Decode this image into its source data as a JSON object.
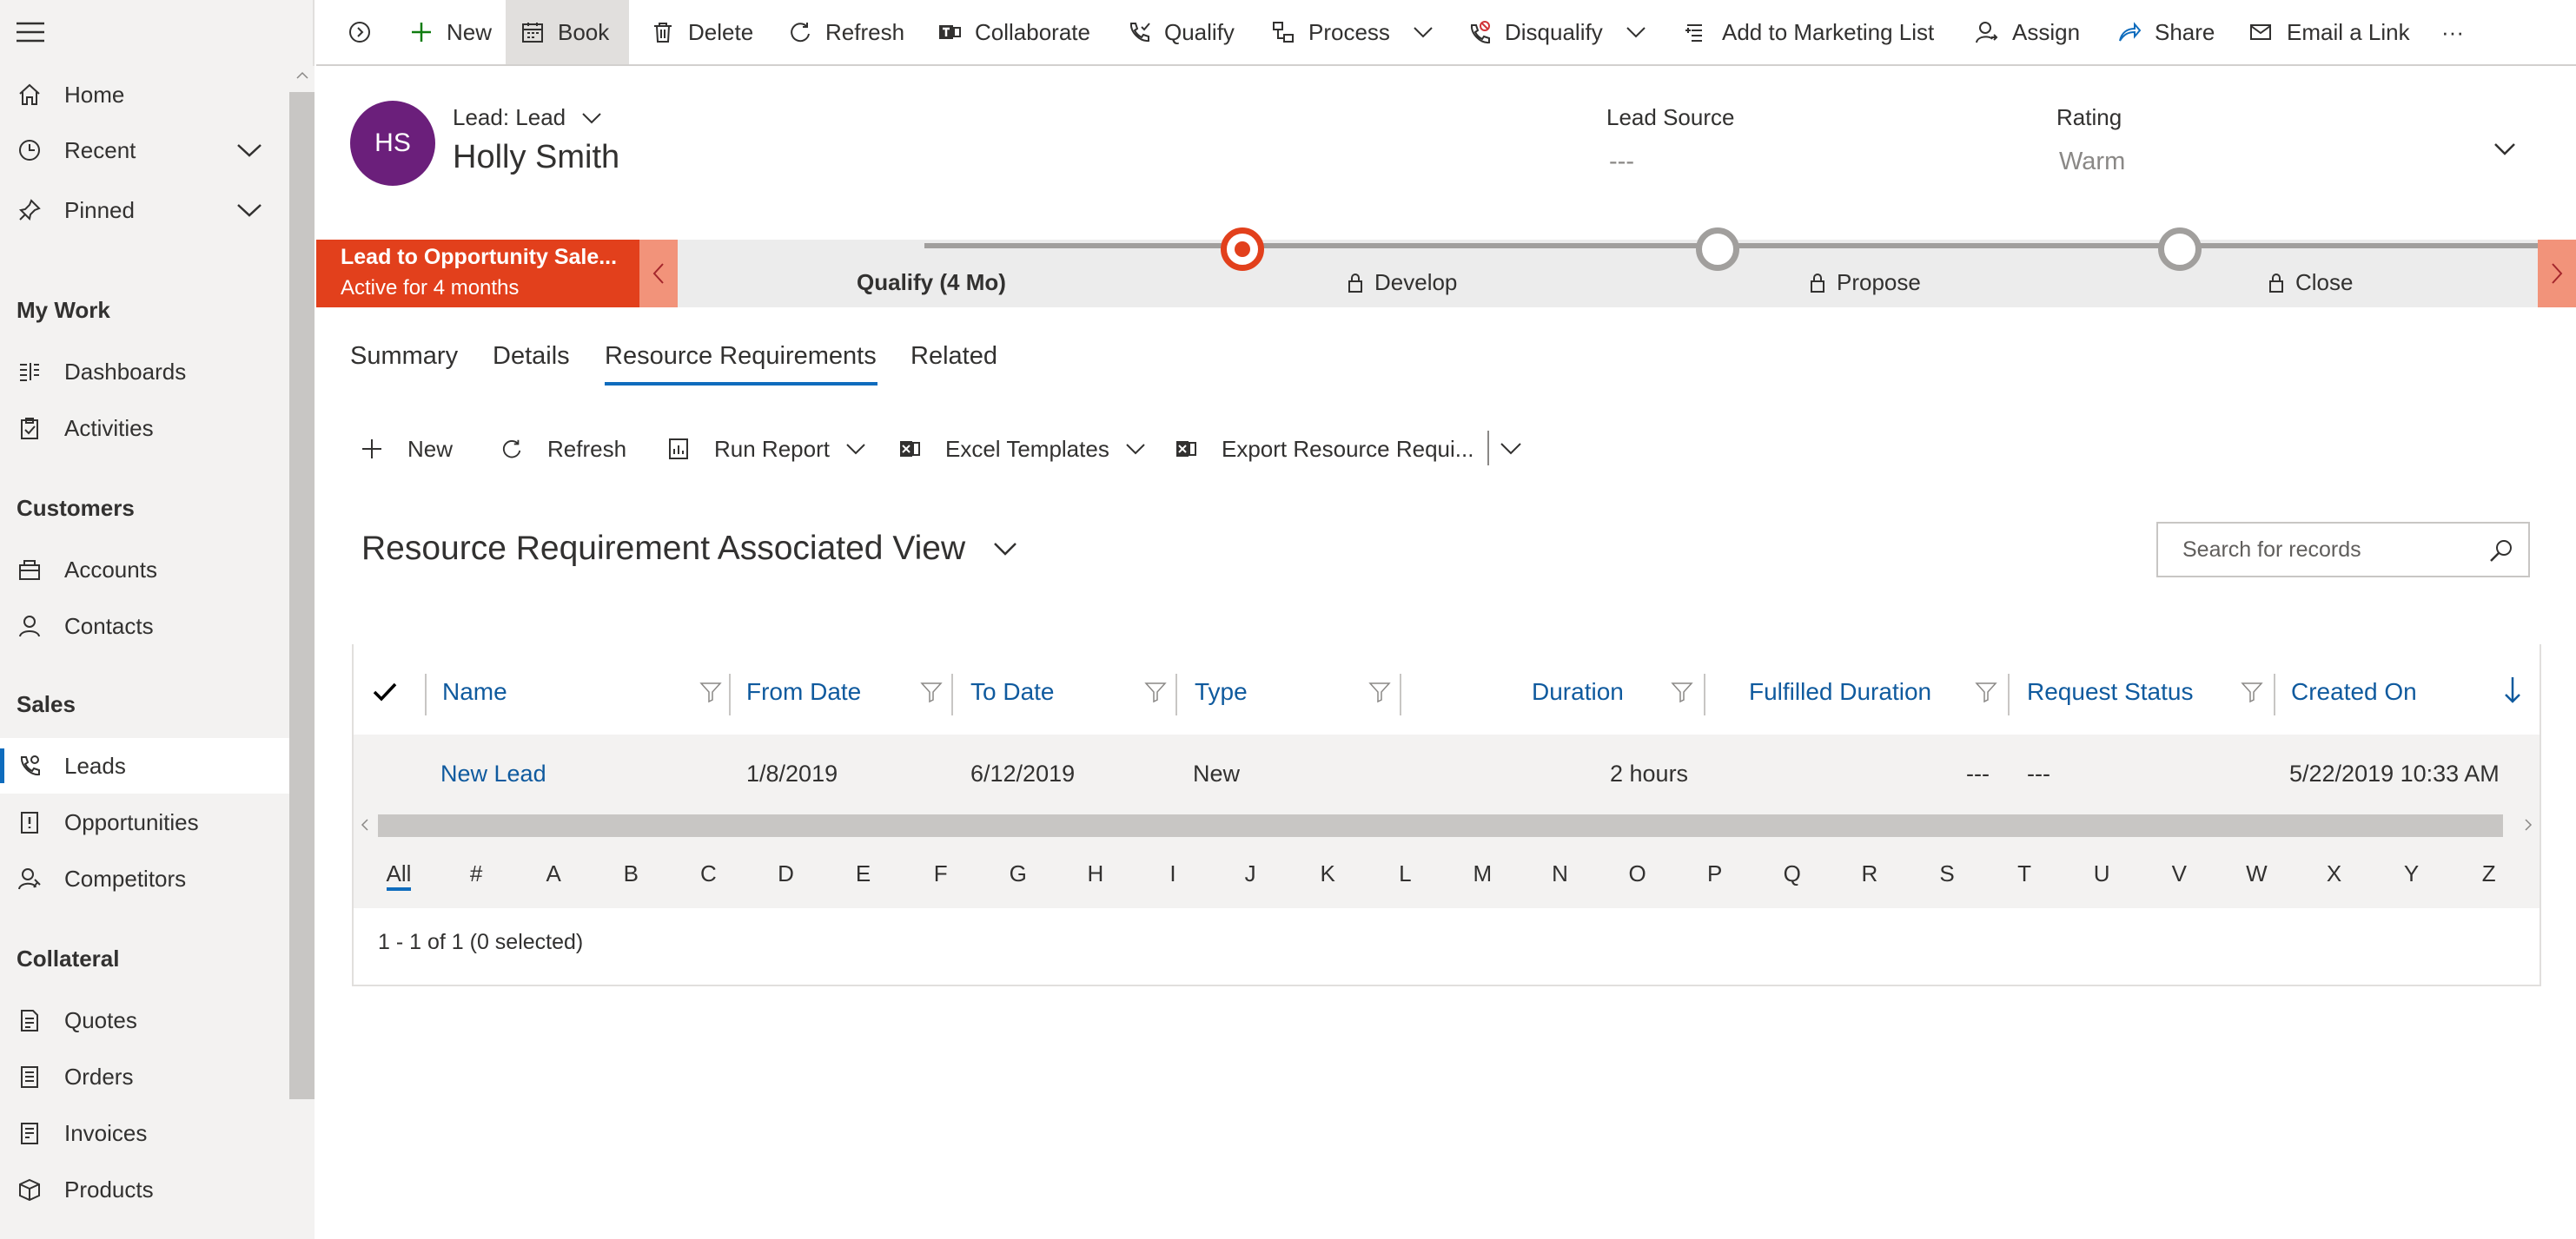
{
  "sidebar": {
    "home": "Home",
    "recent": "Recent",
    "pinned": "Pinned",
    "section_mywork": "My Work",
    "dashboards": "Dashboards",
    "activities": "Activities",
    "section_customers": "Customers",
    "accounts": "Accounts",
    "contacts": "Contacts",
    "section_sales": "Sales",
    "leads": "Leads",
    "opportunities": "Opportunities",
    "competitors": "Competitors",
    "section_collateral": "Collateral",
    "quotes": "Quotes",
    "orders": "Orders",
    "invoices": "Invoices",
    "products": "Products"
  },
  "commands": {
    "new": "New",
    "book": "Book",
    "delete": "Delete",
    "refresh": "Refresh",
    "collaborate": "Collaborate",
    "qualify": "Qualify",
    "process": "Process",
    "disqualify": "Disqualify",
    "add_marketing": "Add to Marketing List",
    "assign": "Assign",
    "share": "Share",
    "email_link": "Email a Link",
    "more": "···"
  },
  "header": {
    "initials": "HS",
    "entity_type": "Lead: Lead",
    "record_name": "Holly Smith",
    "lead_source_label": "Lead Source",
    "lead_source_value": "---",
    "rating_label": "Rating",
    "rating_value": "Warm"
  },
  "bpf": {
    "title": "Lead to Opportunity Sale...",
    "subtitle": "Active for 4 months",
    "stages": {
      "qualify": "Qualify  (4 Mo)",
      "develop": "Develop",
      "propose": "Propose",
      "close": "Close"
    }
  },
  "tabs": {
    "summary": "Summary",
    "details": "Details",
    "resource": "Resource Requirements",
    "related": "Related"
  },
  "subgrid_commands": {
    "new": "New",
    "refresh": "Refresh",
    "run_report": "Run Report",
    "excel_templates": "Excel Templates",
    "export": "Export Resource Requi..."
  },
  "view": {
    "title": "Resource Requirement Associated View",
    "search_placeholder": "Search for records"
  },
  "grid": {
    "columns": {
      "name": "Name",
      "from_date": "From Date",
      "to_date": "To Date",
      "type": "Type",
      "duration": "Duration",
      "fulfilled": "Fulfilled Duration",
      "status": "Request Status",
      "created": "Created On"
    },
    "row": {
      "name": "New Lead",
      "from_date": "1/8/2019",
      "to_date": "6/12/2019",
      "type": "New",
      "duration": "2 hours",
      "fulfilled": "---",
      "status": "---",
      "created": "5/22/2019 10:33 AM"
    },
    "jump": [
      "All",
      "#",
      "A",
      "B",
      "C",
      "D",
      "E",
      "F",
      "G",
      "H",
      "I",
      "J",
      "K",
      "L",
      "M",
      "N",
      "O",
      "P",
      "Q",
      "R",
      "S",
      "T",
      "U",
      "V",
      "W",
      "X",
      "Y",
      "Z"
    ],
    "footer": "1 - 1 of 1 (0 selected)"
  },
  "colors": {
    "accent": "#0f6cbd",
    "bpf_active": "#e2401c",
    "avatar": "#6b1f7b",
    "link": "#0f5a9e"
  }
}
